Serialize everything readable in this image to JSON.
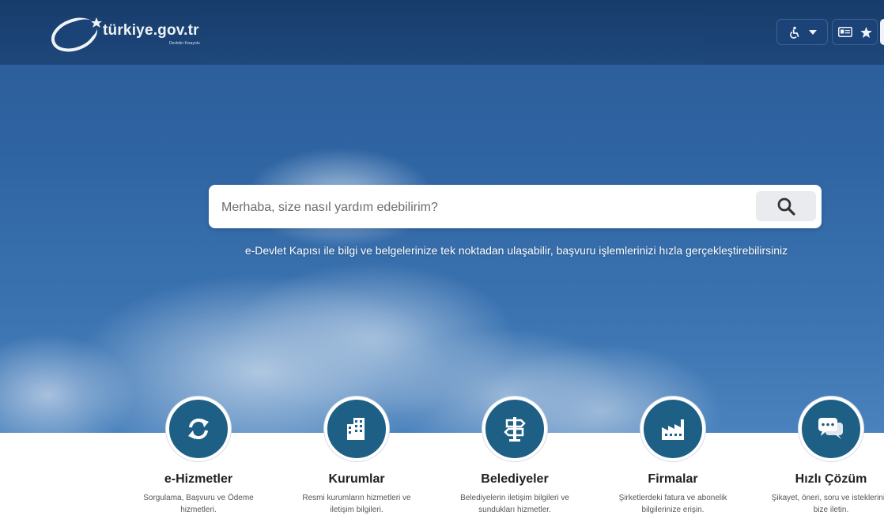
{
  "brand": {
    "name": "türkiye.gov.tr",
    "tagline_small": "Devletin Kısayolu"
  },
  "toolbar": {
    "accessibility_icon": "wheelchair-icon",
    "caret_icon": "caret-down-icon",
    "id_card_icon": "id-card-icon",
    "star_icon": "star-icon"
  },
  "search": {
    "placeholder": "Merhaba, size nasıl yardım edebilirim?",
    "value": "",
    "button_icon": "search-icon"
  },
  "tagline": "e-Devlet Kapısı ile bilgi ve belgelerinize tek noktadan ulaşabilir, başvuru işlemlerinizi hızla gerçekleştirebilirsiniz",
  "categories": [
    {
      "title": "e-Hizmetler",
      "desc": "Sorgulama, Başvuru ve Ödeme hizmetleri.",
      "icon": "refresh-icon"
    },
    {
      "title": "Kurumlar",
      "desc": "Resmi kurumların hizmetleri ve iletişim bilgileri.",
      "icon": "building-icon"
    },
    {
      "title": "Belediyeler",
      "desc": "Belediyelerin iletişim bilgileri ve sundukları hizmetler.",
      "icon": "signpost-icon"
    },
    {
      "title": "Firmalar",
      "desc": "Şirketlerdeki fatura ve abonelik bilgilerinize erişin.",
      "icon": "factory-icon"
    },
    {
      "title": "Hızlı Çözüm",
      "desc": "Şikayet, öneri, soru ve isteklerinizi bize iletin.",
      "icon": "chat-icon"
    }
  ],
  "colors": {
    "topbar": "#163a68",
    "accent_circle": "#1e5f86",
    "sky": "#2f64a2"
  }
}
